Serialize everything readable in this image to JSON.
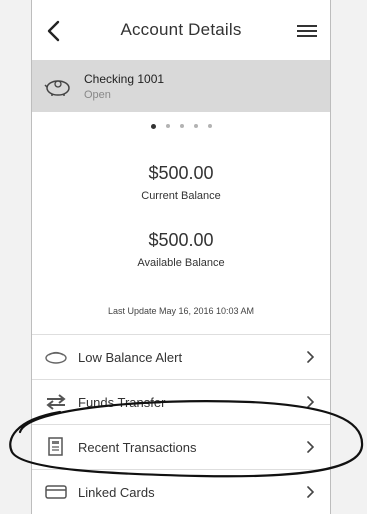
{
  "header": {
    "title": "Account Details"
  },
  "account": {
    "name": "Checking 1001",
    "status": "Open"
  },
  "pager": {
    "total": 5,
    "current": 1
  },
  "balances": {
    "current": {
      "amount": "$500.00",
      "label": "Current Balance"
    },
    "available": {
      "amount": "$500.00",
      "label": "Available Balance"
    }
  },
  "last_update": "Last Update May 16, 2016 10:03 AM",
  "menu": {
    "items": [
      {
        "label": "Low Balance Alert",
        "icon": "alert-icon"
      },
      {
        "label": "Funds Transfer",
        "icon": "transfer-icon"
      },
      {
        "label": "Recent Transactions",
        "icon": "transactions-icon"
      },
      {
        "label": "Linked Cards",
        "icon": "card-icon"
      }
    ]
  }
}
